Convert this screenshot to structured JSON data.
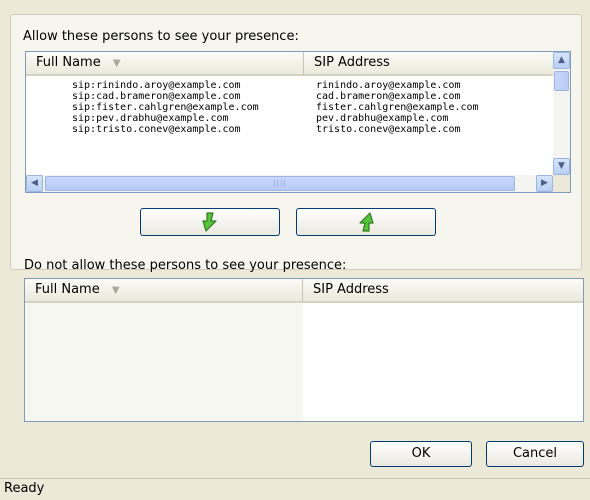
{
  "allowed_section": {
    "label": "Allow these persons to see your presence:",
    "columns": [
      "Full Name",
      "SIP Address"
    ],
    "rows": [
      {
        "full_name": "sip:rinindo.aroy@example.com",
        "sip_address": "rinindo.aroy@example.com"
      },
      {
        "full_name": "sip:cad.brameron@example.com",
        "sip_address": "cad.brameron@example.com"
      },
      {
        "full_name": "sip:fister.cahlgren@example.com",
        "sip_address": "fister.cahlgren@example.com"
      },
      {
        "full_name": "sip:pev.drabhu@example.com",
        "sip_address": "pev.drabhu@example.com"
      },
      {
        "full_name": "sip:tristo.conev@example.com",
        "sip_address": "tristo.conev@example.com"
      }
    ]
  },
  "blocked_section": {
    "label": "Do not allow these persons to see your presence:",
    "columns": [
      "Full Name",
      "SIP Address"
    ],
    "rows": []
  },
  "move_buttons": [
    {
      "name": "move-down-button",
      "icon": "green-arrow-down-icon"
    },
    {
      "name": "move-up-button",
      "icon": "green-arrow-up-icon"
    }
  ],
  "footer": {
    "ok_label": "OK",
    "cancel_label": "Cancel"
  },
  "status": {
    "text": "Ready"
  },
  "colors": {
    "background": "#ece9d8",
    "accent_border": "#7f9db9",
    "arrow_green": "#3fae2a"
  }
}
